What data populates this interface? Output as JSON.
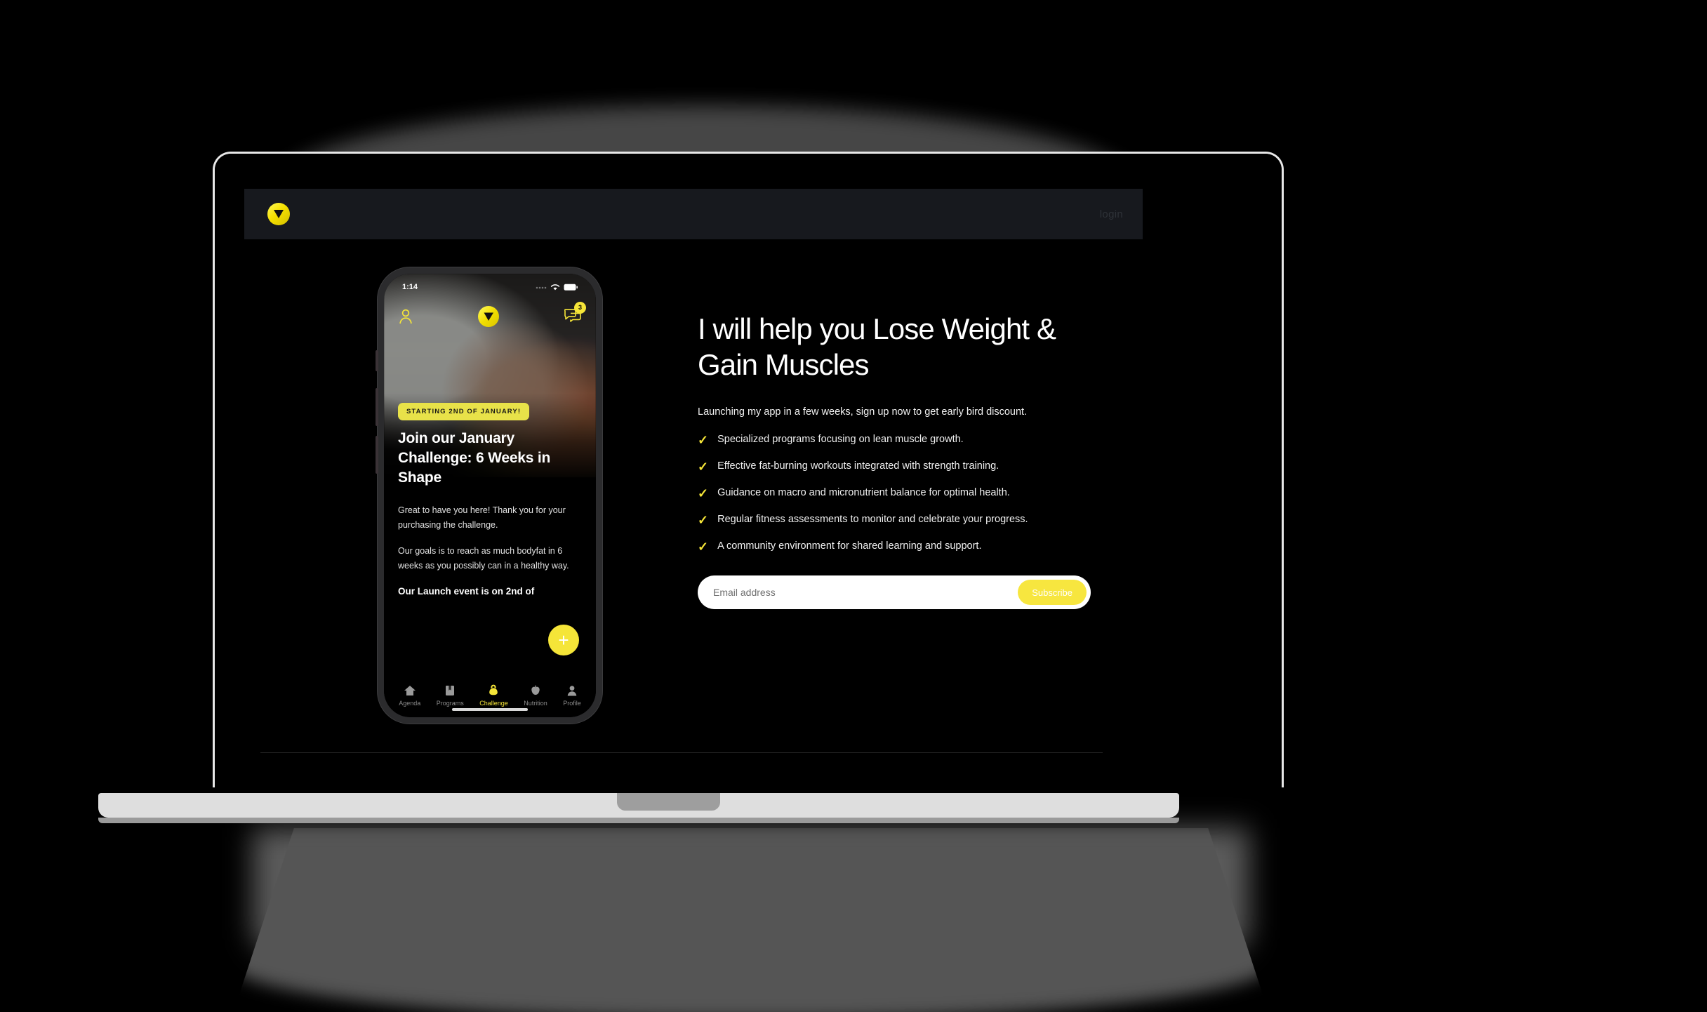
{
  "site": {
    "brand_icon": "yellow-play-circle-logo",
    "login_label": "login"
  },
  "hero": {
    "headline": "I will help you Lose Weight & Gain Muscles",
    "subtitle": "Launching my app in a few weeks, sign up now to get early bird discount.",
    "features": [
      "Specialized programs focusing on lean muscle growth.",
      "Effective fat-burning workouts integrated with strength training.",
      "Guidance on macro and micronutrient balance for optimal health.",
      "Regular fitness assessments to monitor and celebrate your progress.",
      "A community environment for shared learning and support."
    ],
    "check_icon": "check-icon"
  },
  "subscribe": {
    "placeholder": "Email address",
    "value": "",
    "button_label": "Subscribe"
  },
  "phone": {
    "status": {
      "time": "1:14",
      "signal_icon": "signal-dots-icon",
      "wifi_icon": "wifi-icon",
      "battery_icon": "battery-icon"
    },
    "topbar": {
      "profile_icon": "person-outline-icon",
      "logo_icon": "yellow-play-circle-logo",
      "chat_icon": "chat-bubbles-icon",
      "chat_badge": "3"
    },
    "card": {
      "badge": "STARTING 2ND OF JANUARY!",
      "title": "Join our January Challenge: 6 Weeks in Shape",
      "paragraph_1": "Great to have you here!  Thank you for your purchasing the challenge.",
      "paragraph_2": "Our goals is to reach as much bodyfat in 6 weeks as you possibly can in a healthy way.",
      "paragraph_3": "Our Launch event is on 2nd of",
      "fab_label": "+",
      "fab_icon": "plus-icon"
    },
    "tabs": [
      {
        "label": "Agenda",
        "icon": "home-icon",
        "active": false
      },
      {
        "label": "Programs",
        "icon": "book-icon",
        "active": false
      },
      {
        "label": "Challenge",
        "icon": "kettlebell-icon",
        "active": true
      },
      {
        "label": "Nutrition",
        "icon": "apple-icon",
        "active": false
      },
      {
        "label": "Profile",
        "icon": "person-icon",
        "active": false
      }
    ]
  },
  "colors": {
    "accent_yellow": "#F5E538",
    "header_bg": "#17191e",
    "page_bg": "#000000",
    "laptop_frame": "#e8e8e8",
    "laptop_base": "#dedede"
  }
}
